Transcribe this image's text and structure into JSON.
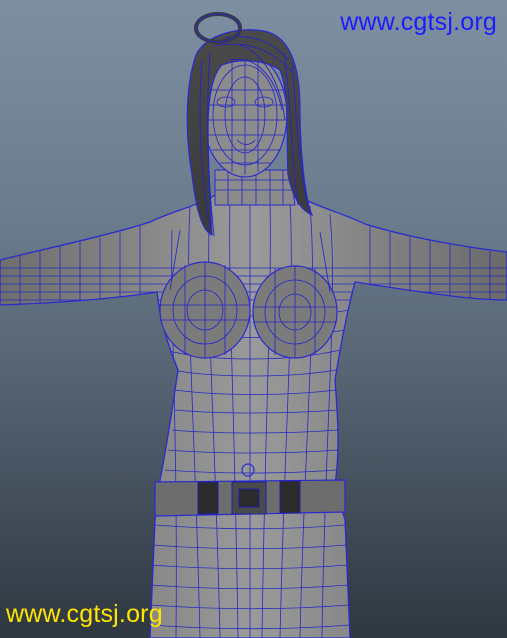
{
  "viewport": {
    "background_top": "#7d8fa0",
    "background_bottom": "#2f3740",
    "mesh_color": "#2a2ad0",
    "skin_color": "#8a8a8a"
  },
  "watermarks": {
    "top": {
      "text": "www.cgtsj.org",
      "color": "#1c1cff"
    },
    "bottom": {
      "text": "www.cgtsj.org",
      "color": "#ffe600"
    }
  }
}
